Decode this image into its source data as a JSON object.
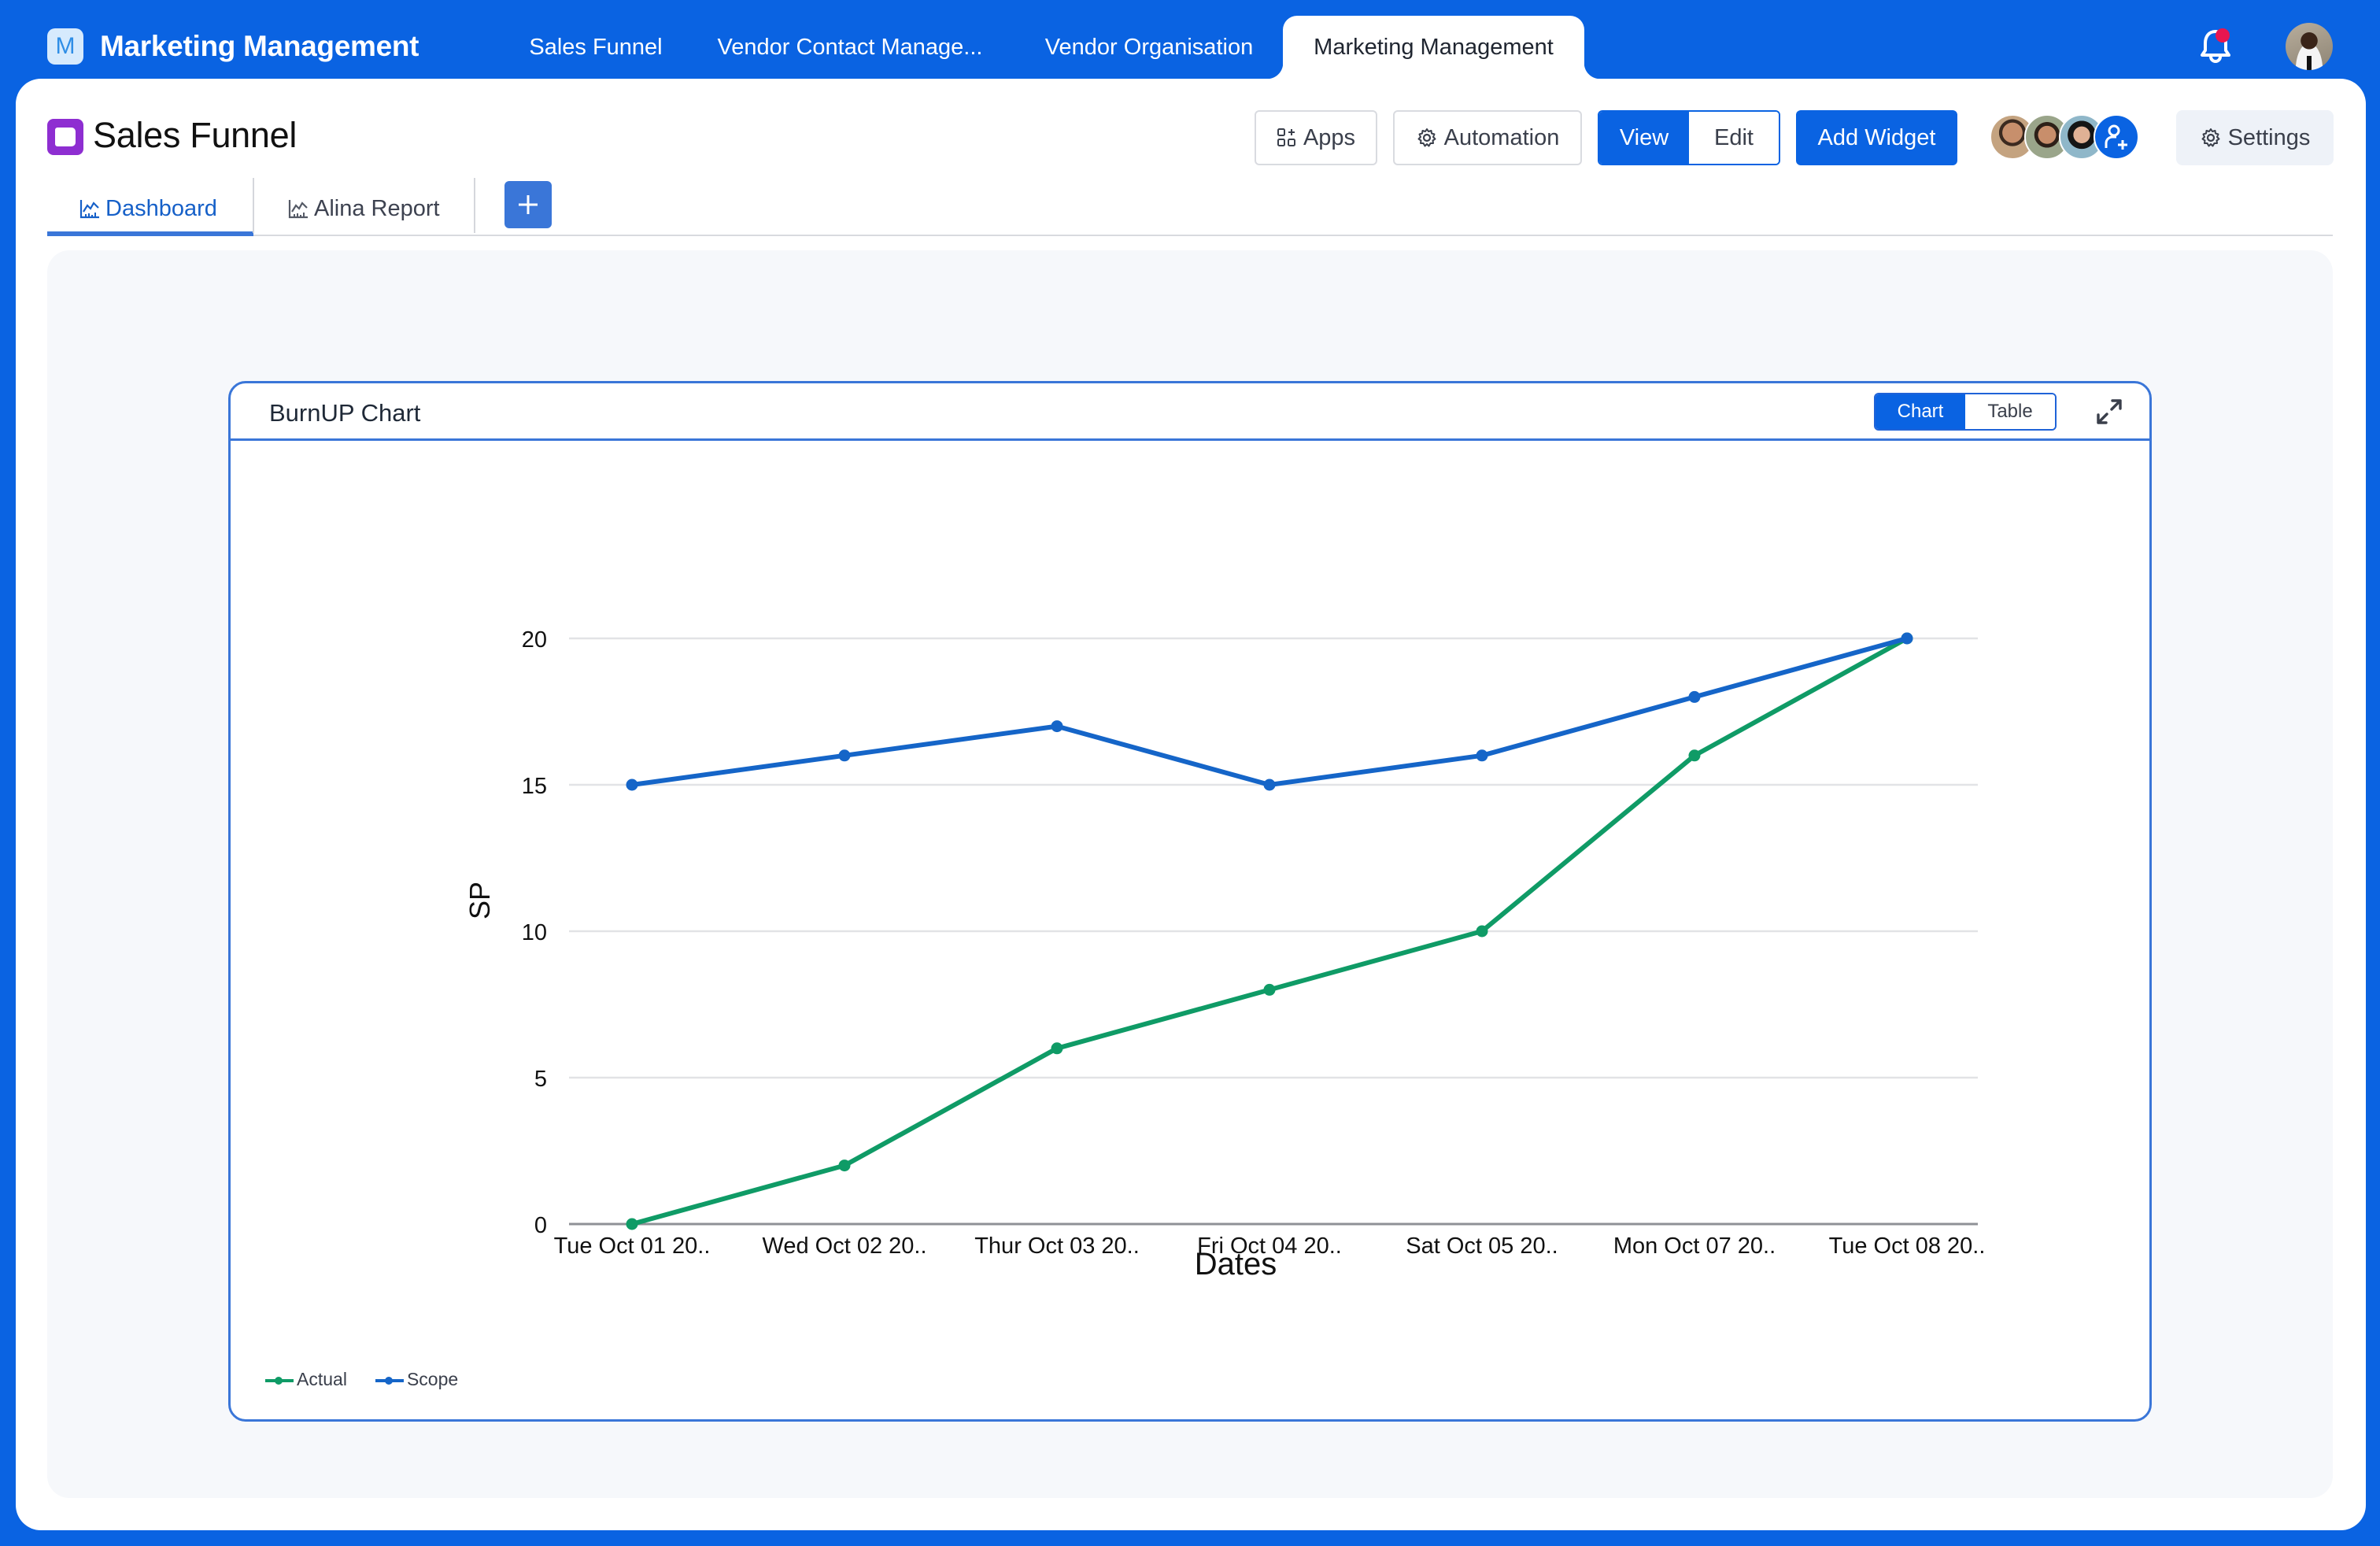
{
  "app": {
    "logo_letter": "M",
    "title": "Marketing Management",
    "brand_color": "#0a63e2"
  },
  "top_tabs": [
    {
      "label": "Sales Funnel",
      "active": false
    },
    {
      "label": "Vendor Contact Manage...",
      "active": false
    },
    {
      "label": "Vendor Organisation",
      "active": false
    },
    {
      "label": "Marketing Management",
      "active": true
    }
  ],
  "header_icons": {
    "notifications": "bell-icon",
    "notification_badge_color": "#e8164f",
    "user": "user-avatar"
  },
  "page": {
    "icon": "page-icon",
    "icon_color": "#8e2ed1",
    "title": "Sales Funnel"
  },
  "toolbar": {
    "apps_label": "Apps",
    "automation_label": "Automation",
    "view_label": "View",
    "edit_label": "Edit",
    "mode_selected": "View",
    "add_widget_label": "Add Widget",
    "settings_label": "Settings",
    "members": [
      "member-1",
      "member-2",
      "member-3"
    ],
    "add_member_icon": "add-user-icon"
  },
  "sub_tabs": [
    {
      "label": "Dashboard",
      "icon": "chart-icon",
      "active": true
    },
    {
      "label": "Alina Report",
      "icon": "chart-icon",
      "active": false
    }
  ],
  "add_tab_icon": "plus-icon",
  "widget": {
    "title": "BurnUP Chart",
    "toggle": {
      "chart_label": "Chart",
      "table_label": "Table",
      "selected": "Chart"
    },
    "expand_icon": "expand-icon"
  },
  "chart_data": {
    "type": "line",
    "title": "BurnUP Chart",
    "xlabel": "Dates",
    "ylabel": "SP",
    "categories": [
      "Tue Oct 01 20..",
      "Wed Oct 02 20..",
      "Thur Oct 03 20..",
      "Fri Oct 04 20..",
      "Sat Oct 05 20..",
      "Mon Oct 07 20..",
      "Tue Oct 08 20.."
    ],
    "series": [
      {
        "name": "Actual",
        "color": "#0f9b66",
        "values": [
          0,
          2,
          6,
          8,
          10,
          16,
          20
        ]
      },
      {
        "name": "Scope",
        "color": "#1565c8",
        "values": [
          15,
          16,
          17,
          15,
          16,
          18,
          20
        ]
      }
    ],
    "ylim": [
      0,
      20
    ],
    "yticks": [
      0,
      5,
      10,
      15,
      20
    ],
    "grid": true,
    "legend_position": "bottom-left"
  }
}
